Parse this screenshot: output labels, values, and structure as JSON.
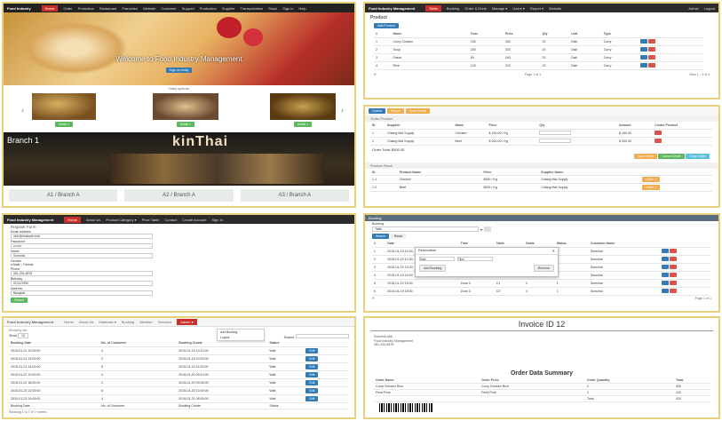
{
  "p1": {
    "nav_brand": "Food Industry",
    "nav_items": [
      "Home",
      "Order",
      "Promotion",
      "Restaurant",
      "Franchise",
      "Website",
      "Customer",
      "Support",
      "Production",
      "Supplier",
      "Transportation",
      "Stock",
      "Sign in",
      "Help"
    ],
    "hero_title": "Welcome to Food Industry Management",
    "hero_button": "Sign up today",
    "carousel_label": "Daily special",
    "dish_buttons": [
      "Detail »",
      "Detail »",
      "Detail »"
    ],
    "branch_title": "Branch 1",
    "brand_sign": "kinThai",
    "boxes": [
      "A1 / Branch A",
      "A2 / Branch A",
      "A3 / Branch A"
    ]
  },
  "p2": {
    "nav_brand": "Food Industry Management",
    "nav_items": [
      "Table",
      "Booking",
      "Order & Drink",
      "Manage ▾",
      "Users ▾",
      "Report ▾",
      "Website"
    ],
    "nav_right": [
      "Admin",
      "Logout"
    ],
    "title": "Product",
    "add_button": "Add Product",
    "headers": [
      "#",
      "Name",
      "Cost",
      "Price",
      "Qty",
      "Unit",
      "Type",
      ""
    ],
    "rows": [
      [
        "1",
        "Curry Chicken",
        "150",
        "250",
        "20",
        "Dish",
        "Curry"
      ],
      [
        "2",
        "Soup",
        "200",
        "320",
        "20",
        "Dish",
        "Curry"
      ],
      [
        "3",
        "Pasta",
        "80",
        "160",
        "20",
        "Dish",
        "Curry"
      ],
      [
        "4",
        "Rice",
        "120",
        "210",
        "20",
        "Dish",
        "Curry"
      ]
    ],
    "pager": "Page 1 of 1",
    "pager_right": "View 1 - 4 of 4"
  },
  "p3": {
    "tabs": [
      "Orders",
      "Report",
      "Order Detail"
    ],
    "section1": "Order Product",
    "headers1": [
      "ID",
      "Supplier",
      "Name",
      "Price",
      "Qty",
      "Amount",
      "Create Product"
    ],
    "rows1": [
      [
        "1",
        "Chiang Mai Supply",
        "Chicken",
        "$ 150.00 / Kg",
        "",
        "$ 150.00",
        "Add"
      ],
      [
        "2",
        "Chiang Mai Supply",
        "Beef",
        "$ 200.00 / Kg",
        "",
        "$ 200.00",
        "Add"
      ]
    ],
    "total": "Order Total: $300.00",
    "actions": [
      "Save Order",
      "Cancel Order",
      "Clear Order"
    ],
    "section2": "Product Stock",
    "headers2": [
      "ID",
      "Product Name",
      "Price",
      "Supplier Name",
      ""
    ],
    "rows2": [
      [
        "1-1",
        "Chicken",
        "$150 / Kg",
        "Chiang Mai Supply",
        "Order »"
      ],
      [
        "1-2",
        "Beef",
        "$200 / Kg",
        "Chiang Mai Supply",
        "Order »"
      ]
    ]
  },
  "p4": {
    "nav_brand": "Food Industry Management",
    "nav_items": [
      "Home",
      "About Us",
      "Product Category ▾",
      "Price Table",
      "Contact",
      "Create Account",
      "Sign In"
    ],
    "title": "Register Form",
    "fields": [
      {
        "label": "Email address",
        "value": "user@example.com"
      },
      {
        "label": "Password",
        "value": "••••••••"
      },
      {
        "label": "Name",
        "value": "Somchai"
      },
      {
        "label": "Gender",
        "value": "● Male ○ Female"
      },
      {
        "label": "Phone",
        "value": "081-234-5678"
      },
      {
        "label": "Birthday",
        "value": "01/01/1990"
      },
      {
        "label": "Address",
        "value": "Bangkok"
      }
    ],
    "submit": "Submit"
  },
  "p5": {
    "title": "Booking",
    "section": "Booking",
    "select_label": "Table",
    "select_value": "Table",
    "tabs": [
      "Search",
      "Reset"
    ],
    "popup_title": "Reservation",
    "popup_select": "Date",
    "popup_input": "Time",
    "popup_btn1": "Add Booking",
    "popup_btn2": "Remove",
    "headers": [
      "#",
      "Date",
      "Time",
      "Table",
      "Seats",
      "Status",
      "Customer Name",
      ""
    ],
    "rows": [
      [
        "1",
        "2015-01-19 12:00",
        "Zone A",
        "A1",
        "4",
        "1",
        "Somchai"
      ],
      [
        "2",
        "2015-01-19 12:30",
        "Zone A",
        "A2",
        "2",
        "1",
        "Somchai"
      ],
      [
        "3",
        "2015-01-19 13:00",
        "Zone B",
        "B1",
        "4",
        "1",
        "Somchai"
      ],
      [
        "4",
        "2015-01-19 14:00",
        "Zone B",
        "B2",
        "6",
        "1",
        "Somchai"
      ],
      [
        "5",
        "2015-01-19 15:00",
        "Zone C",
        "C1",
        "2",
        "1",
        "Somchai"
      ],
      [
        "6",
        "2015-01-19 18:00",
        "Zone C",
        "C2",
        "4",
        "1",
        "Somchai"
      ]
    ],
    "pager": "Page 1 of 1"
  },
  "p6": {
    "nav_brand": "Food Industry Management",
    "nav_items": [
      "Home",
      "About Us",
      "Materials ▾",
      "Booking",
      "Member",
      "Services"
    ],
    "nav_active": "Admin ▾",
    "dropdown": [
      "Add Booking",
      "Logout"
    ],
    "subtitle": "Booking list",
    "filter_label": "Show",
    "filter_value": "10",
    "search_label": "Search:",
    "headers": [
      "Booking Date",
      "No. of Customer",
      "Booking Create",
      "Status",
      ""
    ],
    "rows": [
      [
        "2015-01-21 12:00:00",
        "4",
        "2015-01-19 10:12:00",
        "Wait",
        "Edit"
      ],
      [
        "2015-01-21 13:00:00",
        "2",
        "2015-01-19 10:20:00",
        "Wait",
        "Edit"
      ],
      [
        "2015-01-21 14:00:00",
        "6",
        "2015-01-19 11:02:00",
        "Wait",
        "Edit"
      ],
      [
        "2015-01-22 12:00:00",
        "4",
        "2015-01-20 09:10:00",
        "Wait",
        "Edit"
      ],
      [
        "2015-01-22 18:00:00",
        "2",
        "2015-01-20 09:45:00",
        "Wait",
        "Edit"
      ],
      [
        "2015-01-23 12:00:00",
        "8",
        "2015-01-20 13:00:00",
        "Wait",
        "Edit"
      ],
      [
        "2015-01-23 19:00:00",
        "4",
        "2015-01-21 08:00:00",
        "Wait",
        "Edit"
      ]
    ],
    "footer_row": [
      "Booking Date",
      "No. of Customer",
      "Booking Create",
      "Status"
    ],
    "info": "Showing 1 to 7 of 7 entries"
  },
  "p7": {
    "title": "Invoice ID 12",
    "meta": [
      "Somchai Mai",
      "Food Industry Management",
      "081-234-5678"
    ],
    "summary_title": "Order Data Summary",
    "headers": [
      "Order Name",
      "Order Price",
      "Order Quantity",
      "Total"
    ],
    "rows": [
      [
        "Curry Chicken Rice",
        "Curry Chicken Rice",
        "2",
        "300"
      ],
      [
        "Fried Pork",
        "Fried Pork",
        "1",
        "120"
      ],
      [
        "",
        "",
        "Total",
        "420"
      ]
    ]
  },
  "colors": {
    "border": "#e7d27a",
    "nav": "#2b2b2b",
    "primary": "#337ab7",
    "danger": "#d9534f",
    "success": "#5cb85c",
    "warning": "#f0ad4e"
  }
}
